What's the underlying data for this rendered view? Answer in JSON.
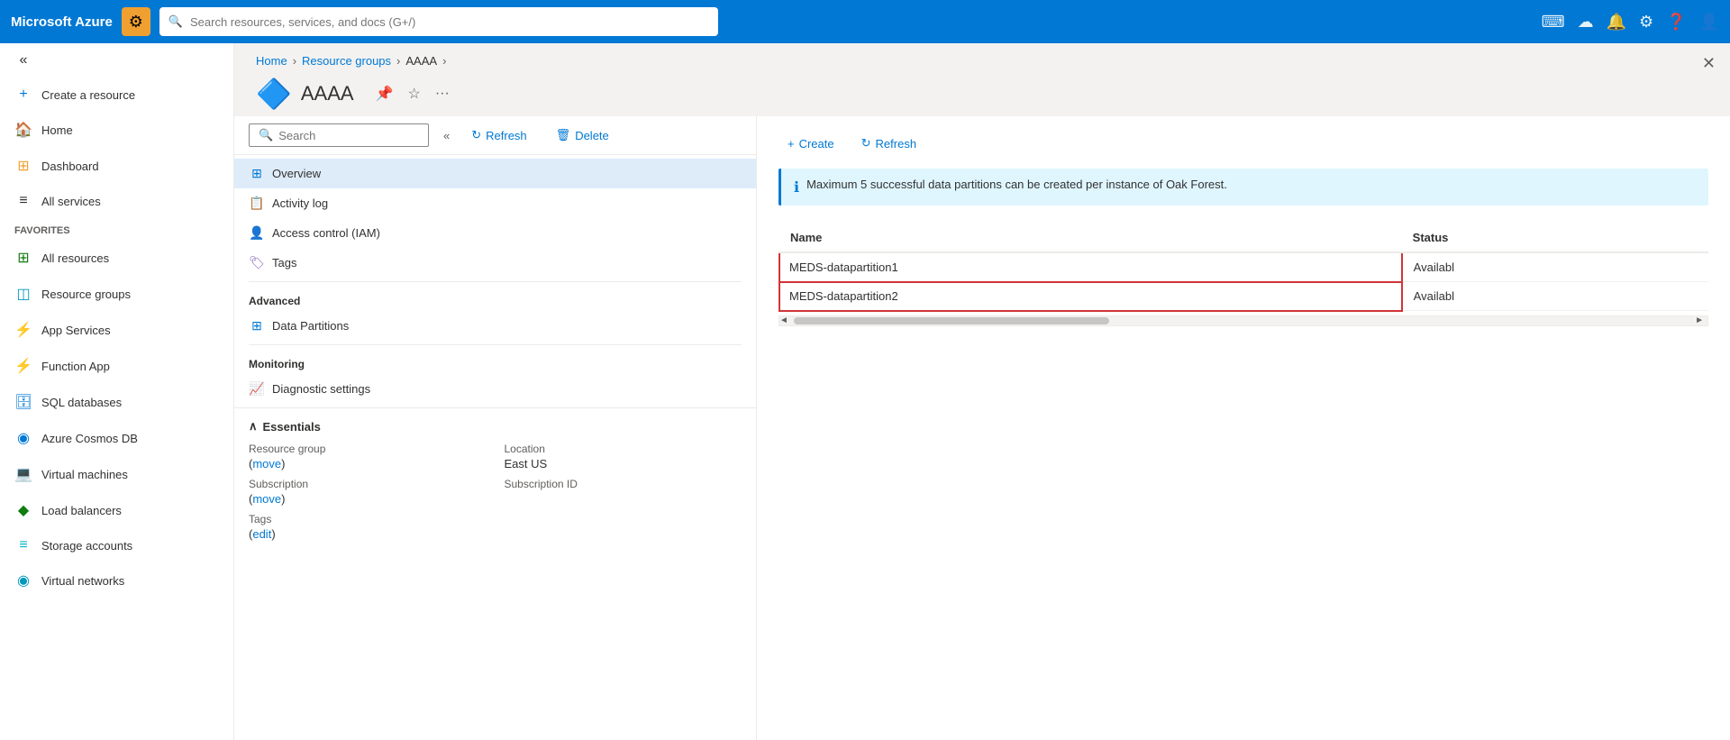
{
  "topbar": {
    "logo": "Microsoft Azure",
    "app_icon": "⚙",
    "search_placeholder": "Search resources, services, and docs (G+/)"
  },
  "sidebar": {
    "collapse_icon": "«",
    "items": [
      {
        "id": "create-resource",
        "label": "Create a resource",
        "icon": "+",
        "icon_color": "blue"
      },
      {
        "id": "home",
        "label": "Home",
        "icon": "🏠",
        "icon_color": ""
      },
      {
        "id": "dashboard",
        "label": "Dashboard",
        "icon": "⊞",
        "icon_color": "orange"
      },
      {
        "id": "all-services",
        "label": "All services",
        "icon": "≡",
        "icon_color": ""
      },
      {
        "id": "favorites-header",
        "label": "FAVORITES",
        "type": "header"
      },
      {
        "id": "all-resources",
        "label": "All resources",
        "icon": "⊞",
        "icon_color": "green"
      },
      {
        "id": "resource-groups",
        "label": "Resource groups",
        "icon": "◫",
        "icon_color": "cyan"
      },
      {
        "id": "app-services",
        "label": "App Services",
        "icon": "⚡",
        "icon_color": "blue"
      },
      {
        "id": "function-app",
        "label": "Function App",
        "icon": "⚡",
        "icon_color": "orange"
      },
      {
        "id": "sql-databases",
        "label": "SQL databases",
        "icon": "🗄",
        "icon_color": "blue"
      },
      {
        "id": "azure-cosmos-db",
        "label": "Azure Cosmos DB",
        "icon": "◉",
        "icon_color": "blue"
      },
      {
        "id": "virtual-machines",
        "label": "Virtual machines",
        "icon": "💻",
        "icon_color": "blue"
      },
      {
        "id": "load-balancers",
        "label": "Load balancers",
        "icon": "◆",
        "icon_color": "green"
      },
      {
        "id": "storage-accounts",
        "label": "Storage accounts",
        "icon": "≡",
        "icon_color": "teal"
      },
      {
        "id": "virtual-networks",
        "label": "Virtual networks",
        "icon": "◉",
        "icon_color": "cyan"
      }
    ]
  },
  "breadcrumb": {
    "items": [
      "Home",
      "Resource groups",
      "AAAA"
    ],
    "links": [
      true,
      true,
      false
    ]
  },
  "resource": {
    "title": "AAAA",
    "icon": "🔷"
  },
  "panel_toolbar": {
    "search_placeholder": "Search",
    "collapse_icon": "«",
    "refresh_label": "Refresh",
    "delete_label": "Delete"
  },
  "nav_items": {
    "overview": "Overview",
    "activity_log": "Activity log",
    "access_control": "Access control (IAM)",
    "tags": "Tags",
    "advanced_section": "Advanced",
    "data_partitions": "Data Partitions",
    "monitoring_section": "Monitoring",
    "diagnostic_settings": "Diagnostic settings"
  },
  "essentials": {
    "header": "Essentials",
    "fields": [
      {
        "label": "Resource group",
        "value": "",
        "link": "move"
      },
      {
        "label": "Location",
        "value": "East US"
      },
      {
        "label": "Subscription",
        "value": "",
        "link": "move"
      },
      {
        "label": "Subscription ID",
        "value": ""
      },
      {
        "label": "Tags",
        "value": "",
        "link": "edit"
      }
    ]
  },
  "right_panel": {
    "create_label": "Create",
    "refresh_label": "Refresh",
    "info_message": "Maximum 5 successful data partitions can be created per instance of Oak Forest.",
    "table": {
      "columns": [
        "Name",
        "Status"
      ],
      "rows": [
        {
          "name": "MEDS-datapartition1",
          "status": "Availabl",
          "highlight": true
        },
        {
          "name": "MEDS-datapartition2",
          "status": "Availabl",
          "highlight": true
        }
      ]
    }
  },
  "icons": {
    "search": "🔍",
    "refresh": "↻",
    "delete": "🗑",
    "create": "+",
    "info": "ℹ",
    "overview": "⊞",
    "activity": "📋",
    "access": "👤",
    "tags": "🏷",
    "data": "⊞",
    "diagnostic": "📈",
    "close": "✕",
    "chevron_down": "∧",
    "star": "☆",
    "pin": "📌",
    "more": "···",
    "scroll_left": "◄",
    "scroll_right": "►"
  }
}
